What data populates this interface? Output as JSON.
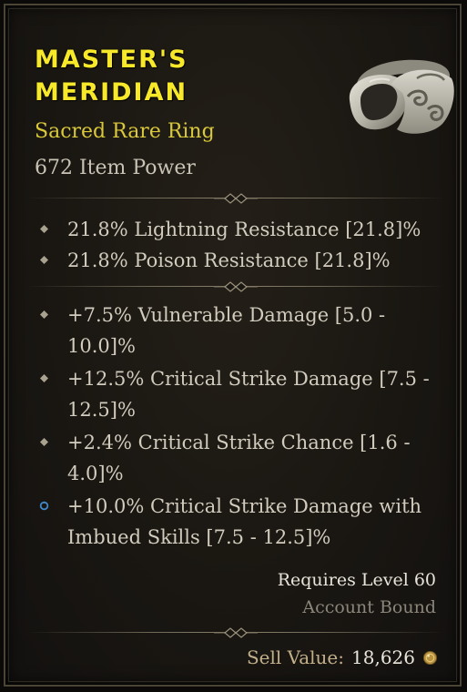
{
  "item": {
    "name_line1": "MASTER'S",
    "name_line2": "MERIDIAN",
    "type": "Sacred Rare Ring",
    "item_power": "672 Item Power",
    "icon": "ring-icon"
  },
  "implicit_stats": [
    {
      "text": "21.8% Lightning Resistance [21.8]%",
      "bullet": "diamond-bullet-icon"
    },
    {
      "text": "21.8% Poison Resistance [21.8]%",
      "bullet": "diamond-bullet-icon"
    }
  ],
  "affixes": [
    {
      "text": "+7.5% Vulnerable Damage [5.0 - 10.0]%",
      "bullet": "diamond-bullet-icon"
    },
    {
      "text": "+12.5% Critical Strike Damage [7.5 - 12.5]%",
      "bullet": "diamond-bullet-icon"
    },
    {
      "text": "+2.4% Critical Strike Chance [1.6 - 4.0]%",
      "bullet": "diamond-bullet-icon"
    },
    {
      "text": "+10.0% Critical Strike Damage with Imbued Skills [7.5 - 12.5]%",
      "bullet": "tempered-affix-icon"
    }
  ],
  "requirements": {
    "level": "Requires Level 60",
    "binding": "Account Bound"
  },
  "sell": {
    "label": "Sell Value:",
    "value": "18,626",
    "icon": "gold-coin-icon"
  },
  "colors": {
    "title": "#f7e92a",
    "subtitle": "#d9c83a",
    "stat_text": "#d2ccbe",
    "tempered_bullet": "#3f86c6"
  }
}
